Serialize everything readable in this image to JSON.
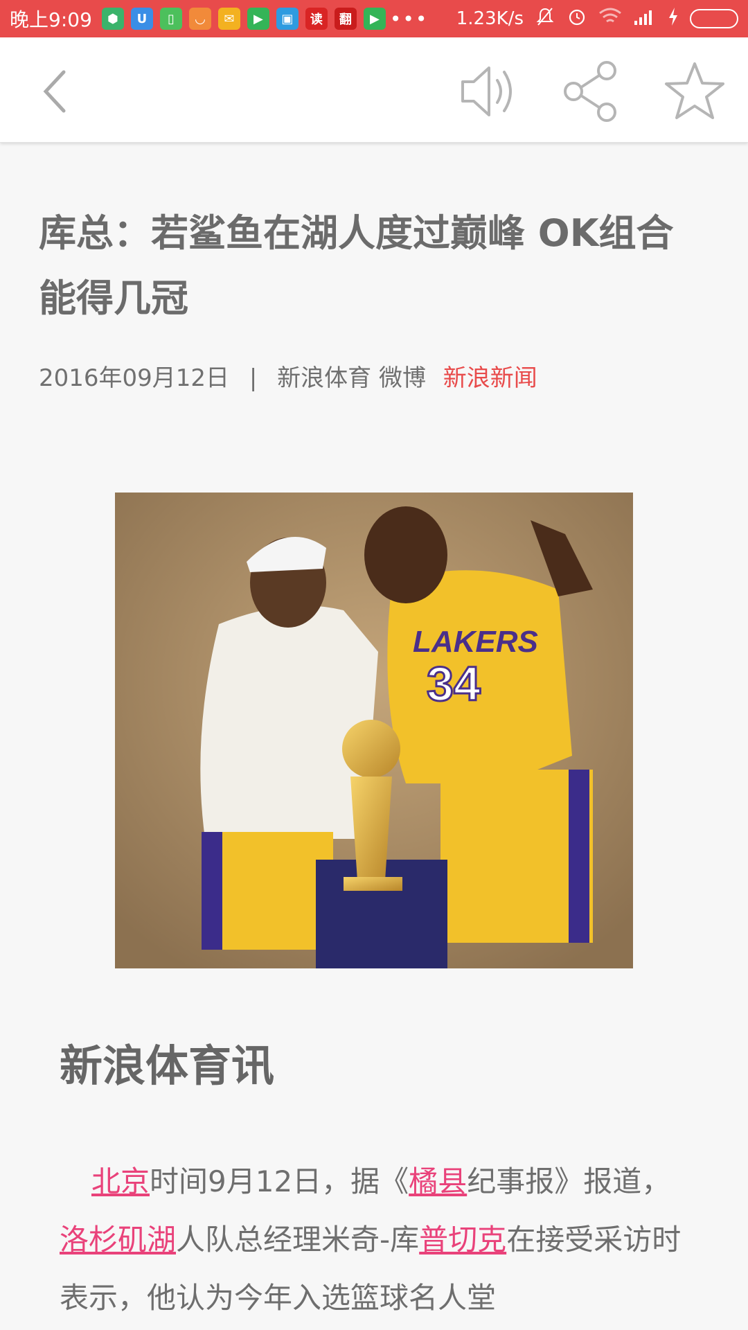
{
  "status_bar": {
    "time": "晚上9:09",
    "app_icons": [
      {
        "name": "shield-app-icon",
        "color": "#3bb36b",
        "glyph": "⬢"
      },
      {
        "name": "u-app-icon",
        "color": "#3a8ee6",
        "glyph": "U"
      },
      {
        "name": "battery-app-icon",
        "color": "#4cc05c",
        "glyph": "▯"
      },
      {
        "name": "mi-app-icon",
        "color": "#f18a3a",
        "glyph": "◡"
      },
      {
        "name": "mail-app-icon",
        "color": "#f3b120",
        "glyph": "✉"
      },
      {
        "name": "play-app-icon",
        "color": "#34b457",
        "glyph": "▶"
      },
      {
        "name": "box-app-icon",
        "color": "#2e9be0",
        "glyph": "▣"
      },
      {
        "name": "read-app-icon",
        "color": "#d92424",
        "glyph": "读"
      },
      {
        "name": "translate-app-icon",
        "color": "#c91c1c",
        "glyph": "翻"
      },
      {
        "name": "video-app-icon",
        "color": "#34b457",
        "glyph": "▶"
      }
    ],
    "more": "•••",
    "speed": "1.23K/s"
  },
  "article": {
    "headline": "库总：若鲨鱼在湖人度过巅峰 OK组合能得几冠",
    "date": "2016年09月12日",
    "separator": "|",
    "author": "新浪体育 微博",
    "source": "新浪新闻",
    "section_title": "新浪体育讯",
    "body": {
      "link_beijing": "北京",
      "t1": "时间9月12日，据《",
      "link_orange_county": "橘县",
      "t2": "纪事报》报道，",
      "link_lakers": "洛杉矶湖",
      "t3": "人队总经理米奇-库",
      "link_kupchak": "普切克",
      "t4": "在接受采访时表示，他认为今年入选篮球名人堂"
    }
  },
  "colors": {
    "status_bar": "#e84b4b",
    "accent_red": "#e84b4b",
    "link_pink": "#e9427a"
  }
}
